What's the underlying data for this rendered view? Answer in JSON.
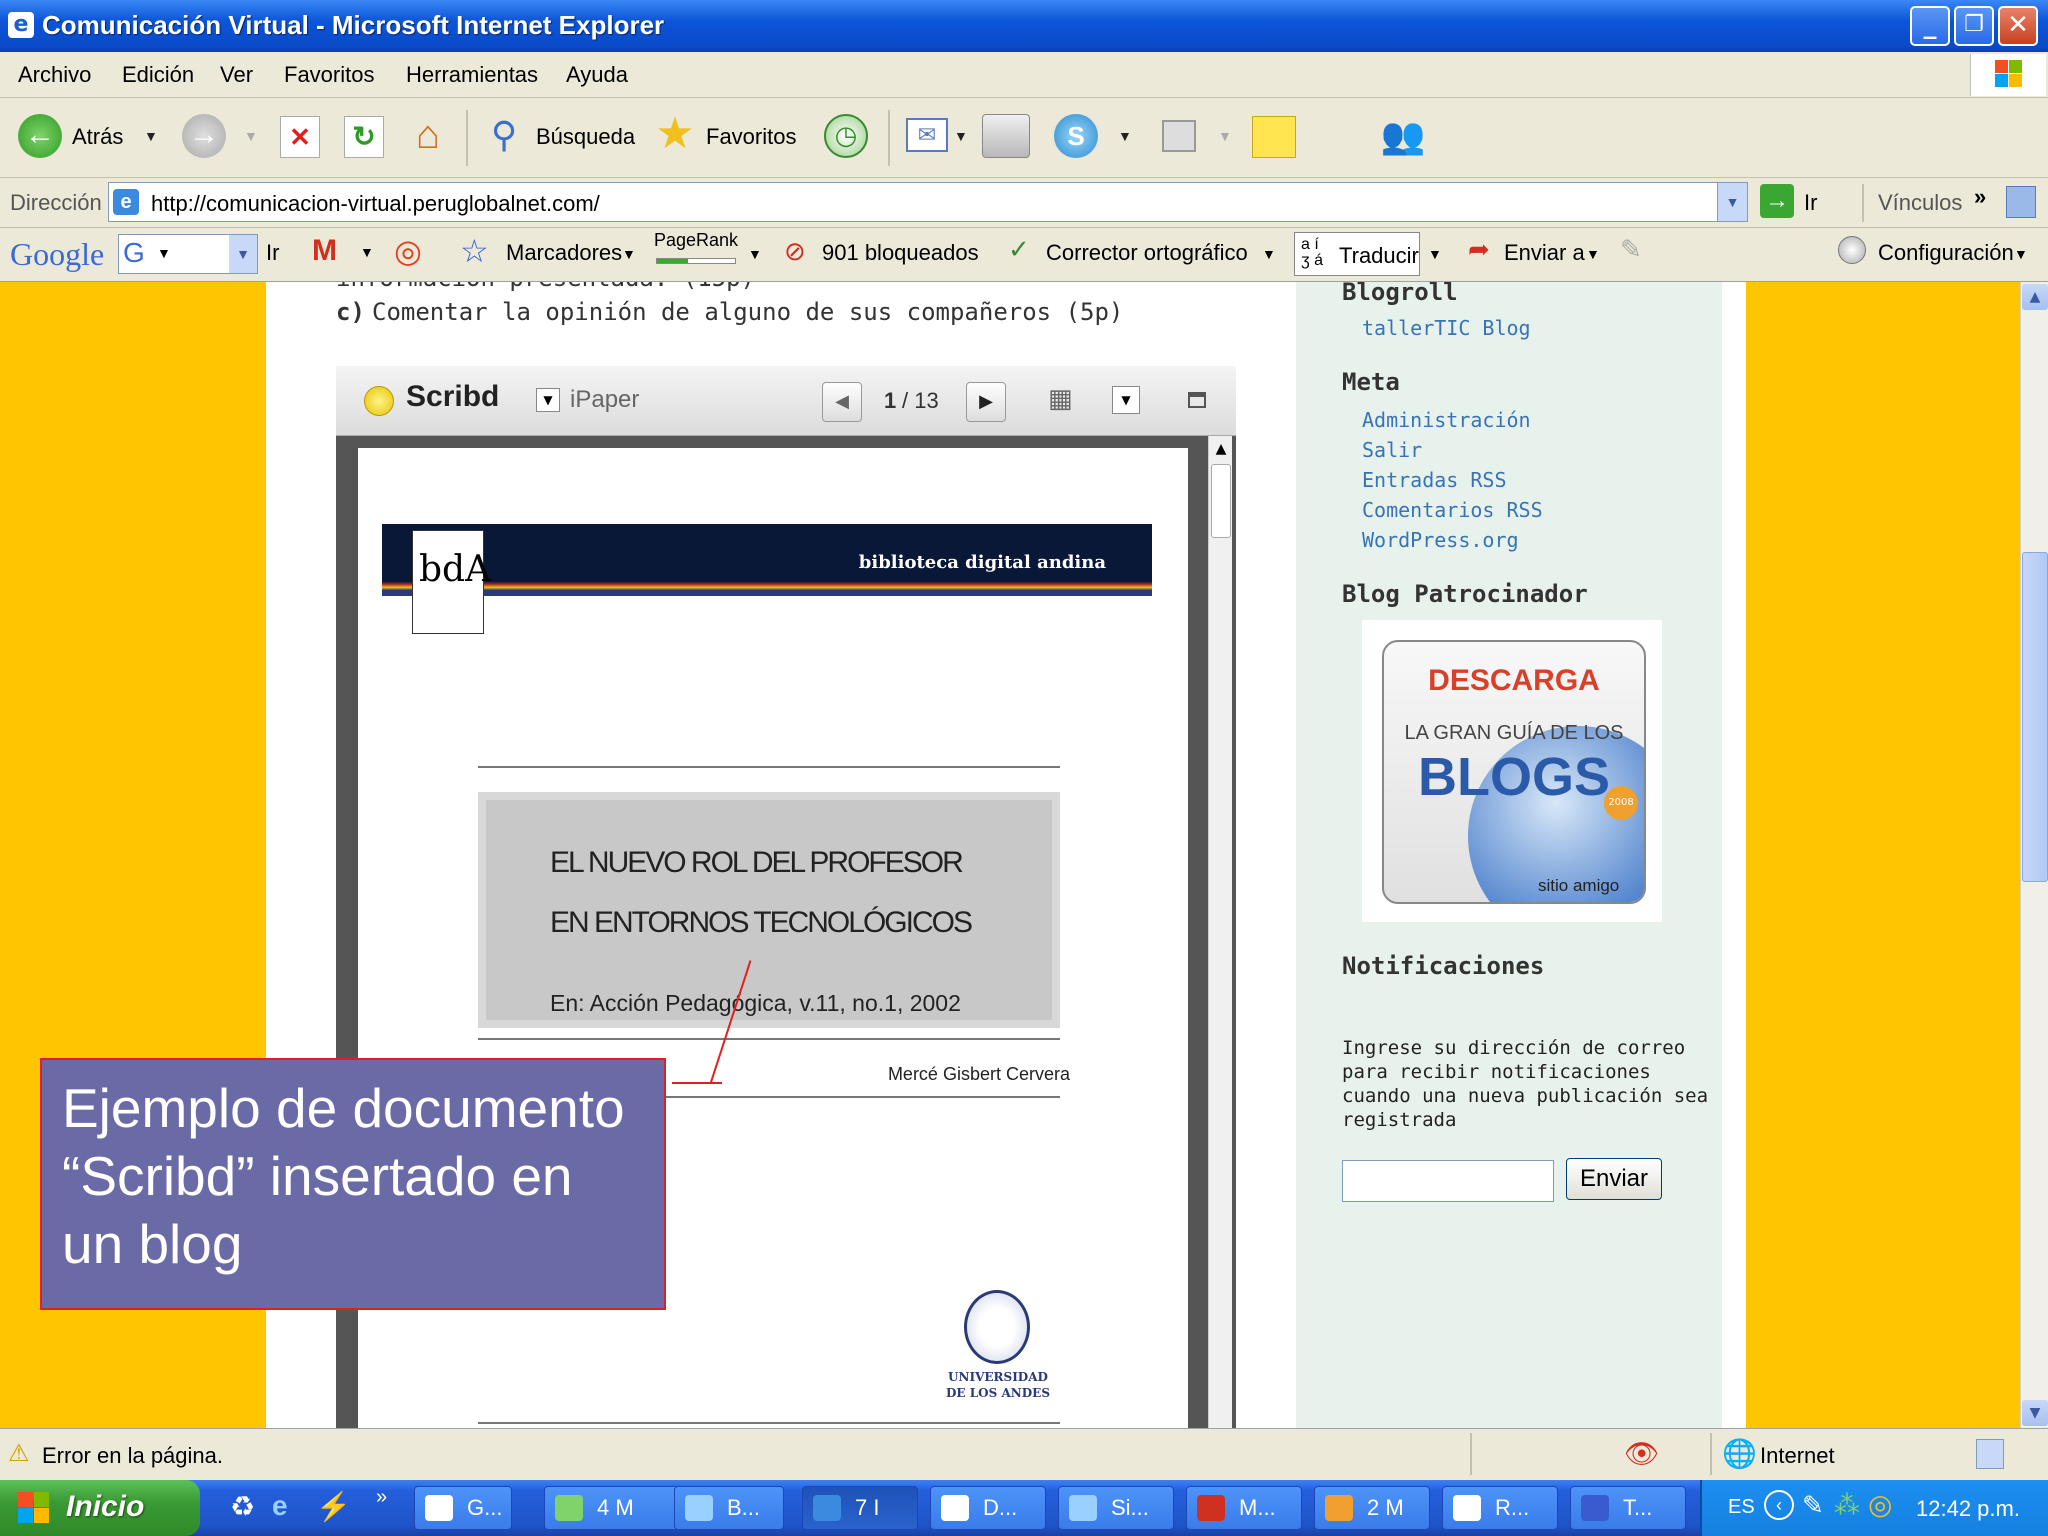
{
  "window": {
    "title": "Comunicación Virtual - Microsoft Internet Explorer"
  },
  "menu": [
    "Archivo",
    "Edición",
    "Ver",
    "Favoritos",
    "Herramientas",
    "Ayuda"
  ],
  "toolbar": {
    "back": "Atrás",
    "search": "Búsqueda",
    "favorites": "Favoritos"
  },
  "address": {
    "label": "Dirección",
    "url": "http://comunicacion-virtual.peruglobalnet.com/",
    "go": "Ir",
    "links": "Vínculos"
  },
  "google_bar": {
    "logo": "Google",
    "go": "Ir",
    "bookmarks": "Marcadores",
    "pagerank": "PageRank",
    "blocked": "901 bloqueados",
    "spell": "Corrector ortográfico",
    "translate": "Traducir",
    "send": "Enviar a",
    "settings": "Configuración"
  },
  "post": {
    "partial_line": "información presentada. (15p)",
    "item_letter": "c)",
    "item_text": "Comentar la opinión de alguno de sus compañeros (5p)"
  },
  "scribd": {
    "brand": "Scribd",
    "mode": "iPaper",
    "page_current": "1",
    "page_total": "/ 13"
  },
  "document": {
    "logo": "bdA",
    "header": "biblioteca digital andina",
    "title_line1": "EL NUEVO ROL DEL PROFESOR",
    "title_line2": "EN ENTORNOS TECNOLÓGICOS",
    "source": "En: Acción Pedagógica, v.11, no.1, 2002",
    "author": "Mercé Gisbert Cervera",
    "university_line1": "UNIVERSIDAD",
    "university_line2": "DE LOS ANDES"
  },
  "callout": {
    "text": "Ejemplo de documento “Scribd” insertado en un blog"
  },
  "sidebar": {
    "blogroll_title": "Blogroll",
    "blogroll": [
      "tallerTIC Blog"
    ],
    "meta_title": "Meta",
    "meta": [
      "Administración",
      "Salir",
      "Entradas RSS",
      "Comentarios RSS",
      "WordPress.org"
    ],
    "sponsor_title": "Blog Patrocinador",
    "ad": {
      "line1": "DESCARGA",
      "line2": "LA GRAN GUÍA DE LOS",
      "line3": "BLOGS",
      "badge": "2008",
      "footer": "sitio amigo"
    },
    "notif_title": "Notificaciones",
    "notif_text": "Ingrese su dirección de correo para recibir notificaciones cuando una nueva publicación sea registrada",
    "email_value": "",
    "submit": "Enviar"
  },
  "status": {
    "text": "Error en la página.",
    "zone": "Internet"
  },
  "taskbar": {
    "start": "Inicio",
    "tasks": [
      "G...",
      "4 M",
      "B...",
      "7 I",
      "D...",
      "Si...",
      "M...",
      "2 M",
      "R...",
      "T..."
    ],
    "lang": "ES",
    "clock": "12:42 p.m."
  },
  "colors": {
    "title_blue": "#0a4ac8",
    "page_yellow": "#ffc600",
    "sidebar_bg": "#e8f2ec",
    "link_blue": "#3873b8",
    "callout_bg": "#6a6aa6",
    "callout_border": "#e02020",
    "ad_red": "#d8402a",
    "ad_blue": "#2a5aa8"
  }
}
